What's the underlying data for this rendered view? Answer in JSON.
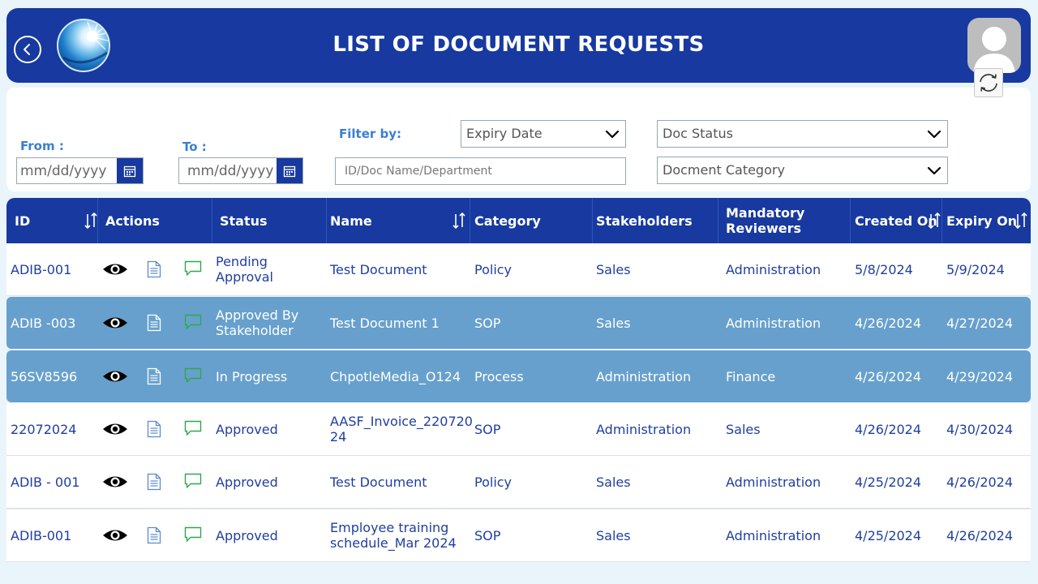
{
  "header": {
    "title": "LIST OF DOCUMENT REQUESTS"
  },
  "filters": {
    "from_label": "From :",
    "to_label": "To :",
    "date_placeholder": "mm/dd/yyyy",
    "filter_by_label": "Filter by:",
    "filter_by_value": "Expiry Date",
    "doc_status_value": "Doc Status",
    "search_placeholder": "ID/Doc Name/Department",
    "category_value": "Docment Category"
  },
  "table": {
    "columns": {
      "id": "ID",
      "actions": "Actions",
      "status": "Status",
      "name": "Name",
      "category": "Category",
      "stakeholders": "Stakeholders",
      "reviewers": "Mandatory Reviewers",
      "created": "Created On",
      "expiry": "Expiry On"
    },
    "rows": [
      {
        "id": "ADIB-001",
        "status": "Pending Approval",
        "name": "Test Document",
        "category": "Policy",
        "stakeholders": "Sales",
        "reviewers": "Administration",
        "created": "5/8/2024",
        "expiry": "5/9/2024"
      },
      {
        "id": "ADIB -003",
        "status": "Approved By Stakeholder",
        "name": "Test Document 1",
        "category": "SOP",
        "stakeholders": "Sales",
        "reviewers": "Administration",
        "created": "4/26/2024",
        "expiry": "4/27/2024"
      },
      {
        "id": "56SV8596",
        "status": "In Progress",
        "name": "ChpotleMedia_O124",
        "category": "Process",
        "stakeholders": "Administration",
        "reviewers": "Finance",
        "created": "4/26/2024",
        "expiry": "4/29/2024"
      },
      {
        "id": "22072024",
        "status": "Approved",
        "name": "AASF_Invoice_220720 24",
        "category": "SOP",
        "stakeholders": "Administration",
        "reviewers": "Sales",
        "created": "4/26/2024",
        "expiry": "4/30/2024"
      },
      {
        "id": "ADIB - 001",
        "status": "Approved",
        "name": "Test Document",
        "category": "Policy",
        "stakeholders": "Sales",
        "reviewers": "Administration",
        "created": "4/25/2024",
        "expiry": "4/26/2024"
      },
      {
        "id": "ADIB-001",
        "status": "Approved",
        "name": "Employee training schedule_Mar 2024",
        "category": "SOP",
        "stakeholders": "Sales",
        "reviewers": "Administration",
        "created": "4/25/2024",
        "expiry": "4/26/2024"
      }
    ]
  },
  "colors": {
    "primary": "#1739a0",
    "accent": "#3a7fcf",
    "selected_row": "#67a0cd",
    "text": "#1f3f9e"
  },
  "icons": [
    "back-arrow-icon",
    "calendar-icon",
    "chevron-down-icon",
    "refresh-icon",
    "sort-icon",
    "eye-icon",
    "document-icon",
    "comment-icon",
    "user-icon"
  ]
}
